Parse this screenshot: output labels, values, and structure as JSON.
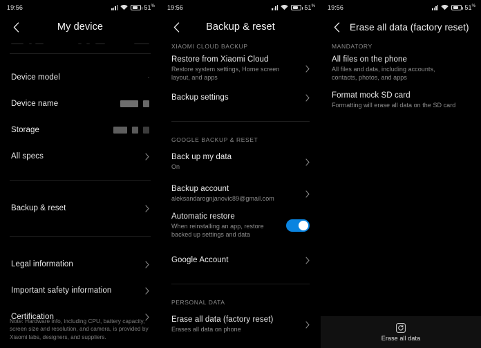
{
  "statusbar": {
    "time": "19:56",
    "battery_text": "51",
    "battery_suffix": "%",
    "icons": [
      "signal-icon",
      "wifi-icon",
      "battery-icon"
    ]
  },
  "panel1": {
    "title": "My device",
    "back_icon": "back-arrow-icon",
    "rows": [
      {
        "title": "Device model",
        "sub": "",
        "chevron": false,
        "redactions": []
      },
      {
        "title": "Device name",
        "sub": "",
        "chevron": false,
        "redactions": [
          {
            "w": 26,
            "c": "#6e6e6e"
          },
          {
            "w": 9,
            "c": "#686868"
          }
        ]
      },
      {
        "title": "Storage",
        "sub": "",
        "chevron": false,
        "redactions": [
          {
            "w": 20,
            "c": "#5e5e5e"
          },
          {
            "w": 9,
            "c": "#5a5a5a"
          },
          {
            "w": 9,
            "c": "#3c3c3c"
          }
        ]
      },
      {
        "title": "All specs",
        "sub": "",
        "chevron": true,
        "redactions": []
      }
    ],
    "rows2": [
      {
        "title": "Backup & reset",
        "chevron": true
      }
    ],
    "rows3": [
      {
        "title": "Legal information",
        "chevron": true
      },
      {
        "title": "Important safety information",
        "chevron": true
      },
      {
        "title": "Certification",
        "chevron": true
      }
    ],
    "note": "Note: Hardware info, including CPU, battery capacity, screen size and resolution, and camera, is provided by Xiaomi labs, designers, and suppliers."
  },
  "panel2": {
    "title": "Backup & reset",
    "back_icon": "back-arrow-icon",
    "section1_header": "XIAOMI CLOUD BACKUP",
    "section1_rows": [
      {
        "title": "Restore from Xiaomi Cloud",
        "sub": "Restore system settings, Home screen layout, and apps",
        "chevron": true
      },
      {
        "title": "Backup settings",
        "sub": "",
        "chevron": true
      }
    ],
    "section2_header": "GOOGLE BACKUP & RESET",
    "section2_rows": [
      {
        "title": "Back up my data",
        "sub": "On",
        "chevron": true
      },
      {
        "title": "Backup account",
        "sub": "aleksandarognjanovic89@gmail.com",
        "chevron": true
      }
    ],
    "toggle_row": {
      "title": "Automatic restore",
      "sub": "When reinstalling an app, restore backed up settings and data",
      "state": "on",
      "accent": "#0a84e0"
    },
    "section2_rows_after": [
      {
        "title": "Google Account",
        "sub": "",
        "chevron": true
      }
    ],
    "section3_header": "PERSONAL DATA",
    "section3_rows": [
      {
        "title": "Erase all data (factory reset)",
        "sub": "Erases all data on phone",
        "chevron": true
      }
    ]
  },
  "panel3": {
    "title": "Erase all data (factory reset)",
    "back_icon": "back-arrow-icon",
    "section_header": "MANDATORY",
    "rows": [
      {
        "title": "All files on the phone",
        "sub": "All files and data, including accounts, contacts, photos, and apps"
      },
      {
        "title": "Format mock SD card",
        "sub": "Formatting will erase all data on the SD card"
      }
    ],
    "bottom_button": {
      "label": "Erase all data",
      "icon": "reset-icon"
    }
  }
}
